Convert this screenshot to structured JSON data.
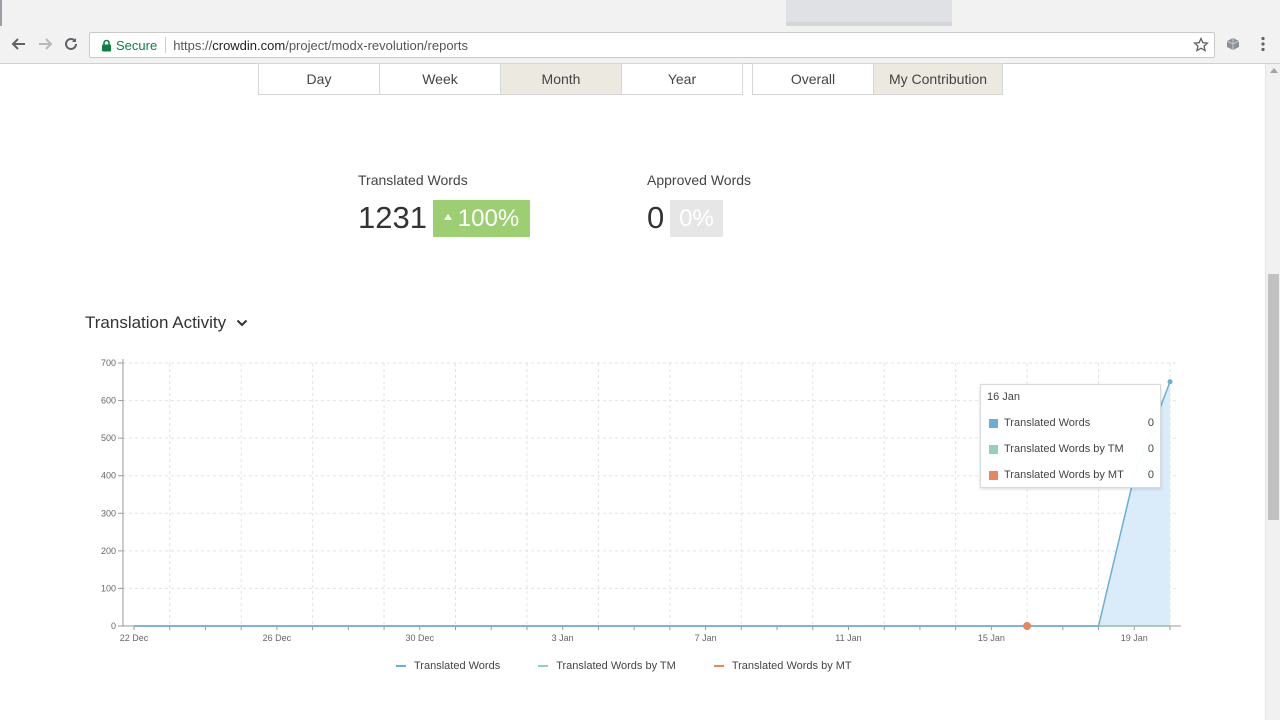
{
  "browser": {
    "secure_label": "Secure",
    "url_scheme": "https://",
    "url_host": "crowdin.com",
    "url_path": "/project/modx-revolution/reports"
  },
  "period_filter": {
    "options": [
      "Day",
      "Week",
      "Month",
      "Year"
    ],
    "selected": "Month"
  },
  "scope_filter": {
    "options": [
      "Overall",
      "My Contribution"
    ],
    "selected": "My Contribution"
  },
  "stats": {
    "translated": {
      "label": "Translated Words",
      "value": "1231",
      "change": "100%"
    },
    "approved": {
      "label": "Approved Words",
      "value": "0",
      "change": "0%"
    }
  },
  "section": {
    "title": "Translation Activity"
  },
  "colors": {
    "translated": "#6baed6",
    "tm": "#8fd3b6",
    "mt": "#e8875a",
    "area_fill": "#d6e9f8",
    "badge_green": "#9cce72"
  },
  "chart_data": {
    "type": "line",
    "title": "",
    "xlabel": "",
    "ylabel": "",
    "ylim": [
      0,
      700
    ],
    "yticks": [
      0,
      100,
      200,
      300,
      400,
      500,
      600,
      700
    ],
    "x_tick_labels": [
      "22 Dec",
      "26 Dec",
      "30 Dec",
      "3 Jan",
      "7 Jan",
      "11 Jan",
      "15 Jan",
      "19 Jan"
    ],
    "x": [
      "22 Dec",
      "23 Dec",
      "24 Dec",
      "25 Dec",
      "26 Dec",
      "27 Dec",
      "28 Dec",
      "29 Dec",
      "30 Dec",
      "31 Dec",
      "1 Jan",
      "2 Jan",
      "3 Jan",
      "4 Jan",
      "5 Jan",
      "6 Jan",
      "7 Jan",
      "8 Jan",
      "9 Jan",
      "10 Jan",
      "11 Jan",
      "12 Jan",
      "13 Jan",
      "14 Jan",
      "15 Jan",
      "16 Jan",
      "17 Jan",
      "18 Jan",
      "19 Jan",
      "20 Jan"
    ],
    "grid": true,
    "legend_position": "bottom",
    "series": [
      {
        "name": "Translated Words",
        "values": [
          0,
          0,
          0,
          0,
          0,
          0,
          0,
          0,
          0,
          0,
          0,
          0,
          0,
          0,
          0,
          0,
          0,
          0,
          0,
          0,
          0,
          0,
          0,
          0,
          0,
          0,
          0,
          0,
          400,
          650
        ]
      },
      {
        "name": "Translated Words by TM",
        "values": [
          0,
          0,
          0,
          0,
          0,
          0,
          0,
          0,
          0,
          0,
          0,
          0,
          0,
          0,
          0,
          0,
          0,
          0,
          0,
          0,
          0,
          0,
          0,
          0,
          0,
          0,
          0,
          0,
          0,
          0
        ]
      },
      {
        "name": "Translated Words by MT",
        "values": [
          0,
          0,
          0,
          0,
          0,
          0,
          0,
          0,
          0,
          0,
          0,
          0,
          0,
          0,
          0,
          0,
          0,
          0,
          0,
          0,
          0,
          0,
          0,
          0,
          0,
          0,
          0,
          0,
          0,
          0
        ]
      }
    ],
    "highlight_index": 25
  },
  "tooltip": {
    "date": "16 Jan",
    "rows": [
      {
        "label": "Translated Words",
        "value": "0"
      },
      {
        "label": "Translated Words by TM",
        "value": "0"
      },
      {
        "label": "Translated Words by MT",
        "value": "0"
      }
    ]
  }
}
